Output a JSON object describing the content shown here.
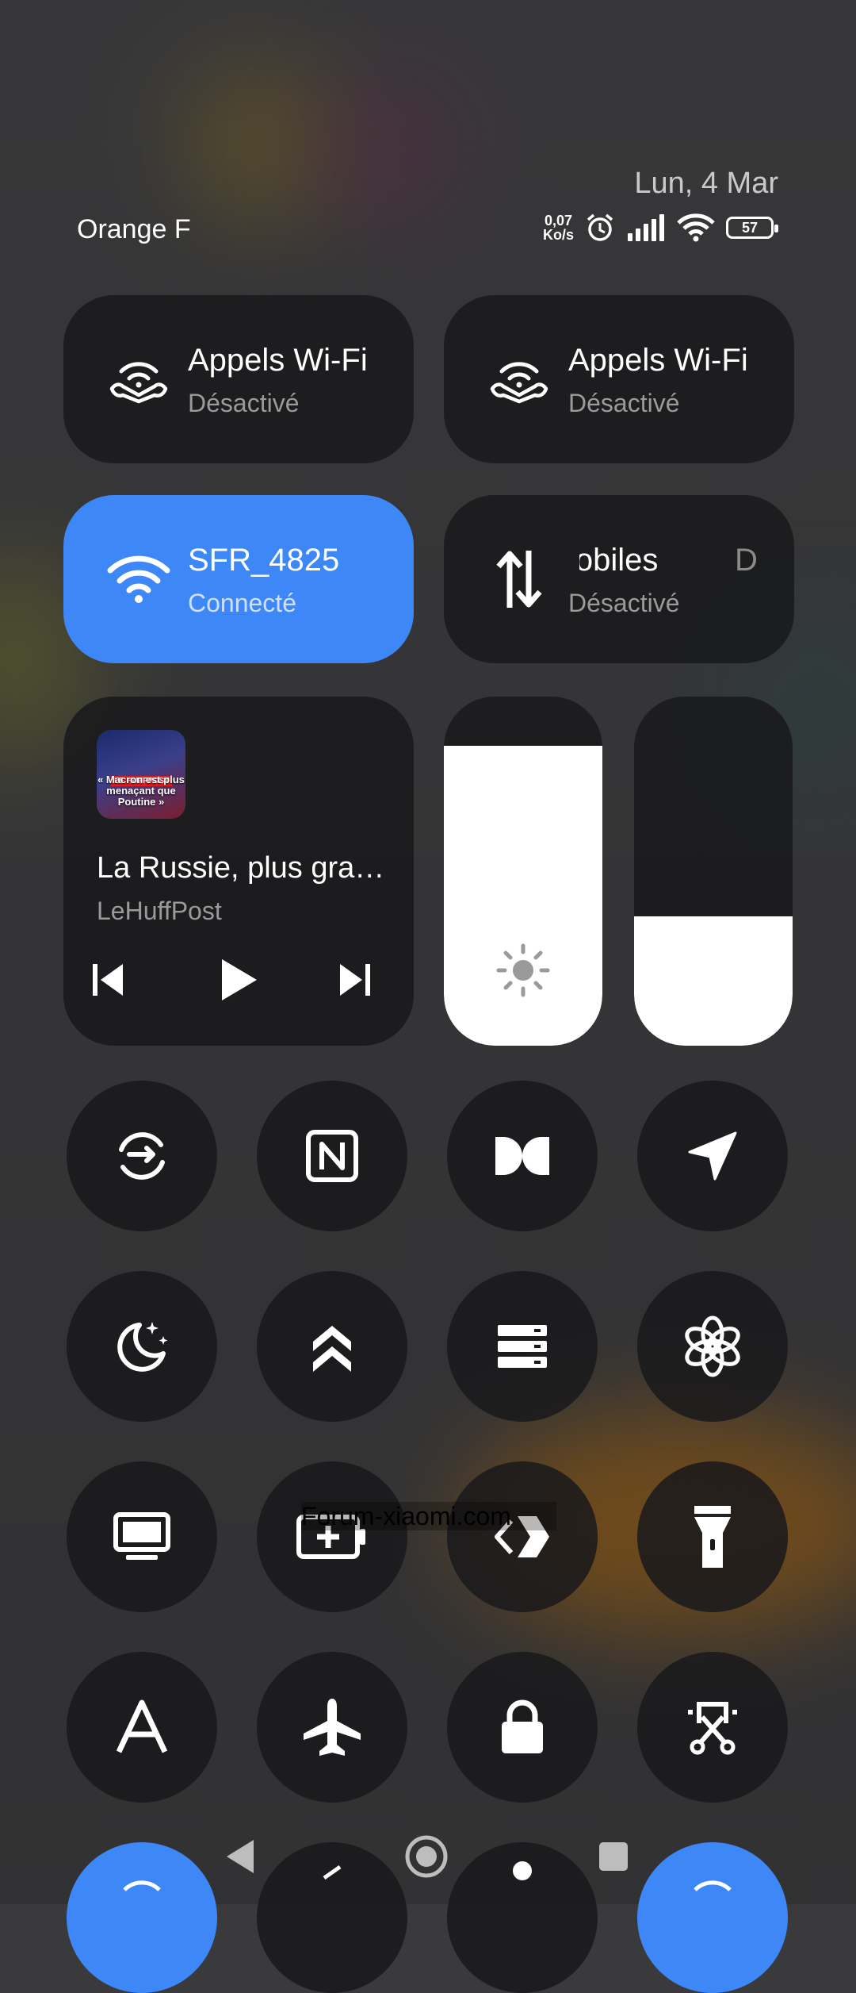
{
  "status": {
    "date": "Lun, 4 Mar",
    "carrier": "Orange F",
    "net_speed_value": "0,07",
    "net_speed_unit": "Ko/s",
    "battery": "57"
  },
  "tiles": [
    {
      "title": "Appels Wi-Fi",
      "subtitle": "Désactivé",
      "icon": "wifi-calling-icon"
    },
    {
      "title": "Appels Wi-Fi",
      "subtitle": "Désactivé",
      "icon": "wifi-calling-icon"
    },
    {
      "title": "SFR_4825",
      "subtitle": "Connecté",
      "icon": "wifi-icon",
      "active": true
    },
    {
      "title": "ᴍobiles",
      "title_visible": "lobiles",
      "title_extra": "D",
      "subtitle": "Désactivé",
      "icon": "mobile-data-icon"
    }
  ],
  "media": {
    "title": "La Russie, plus gra…",
    "source": "LeHuffPost",
    "thumb_caption": "« Macron est plus menaçant que Poutine »"
  },
  "sliders": {
    "brightness_level": 0.86,
    "volume_level": 0.37
  },
  "toggles": [
    {
      "icon": "sync-icon"
    },
    {
      "icon": "nfc-icon"
    },
    {
      "icon": "dolby-icon"
    },
    {
      "icon": "location-icon"
    },
    {
      "icon": "dark-mode-icon"
    },
    {
      "icon": "ultra-battery-icon"
    },
    {
      "icon": "storage-icon"
    },
    {
      "icon": "chatgpt-icon"
    },
    {
      "icon": "screen-cast-icon"
    },
    {
      "icon": "battery-saver-icon"
    },
    {
      "icon": "link-icon"
    },
    {
      "icon": "flashlight-icon"
    },
    {
      "icon": "font-icon"
    },
    {
      "icon": "airplane-mode-icon"
    },
    {
      "icon": "lock-icon"
    },
    {
      "icon": "screenshot-icon"
    }
  ],
  "watermark": "Forum-xiaomi.com",
  "colors": {
    "accent": "#3e87f6",
    "tile_bg": "#19191b"
  }
}
